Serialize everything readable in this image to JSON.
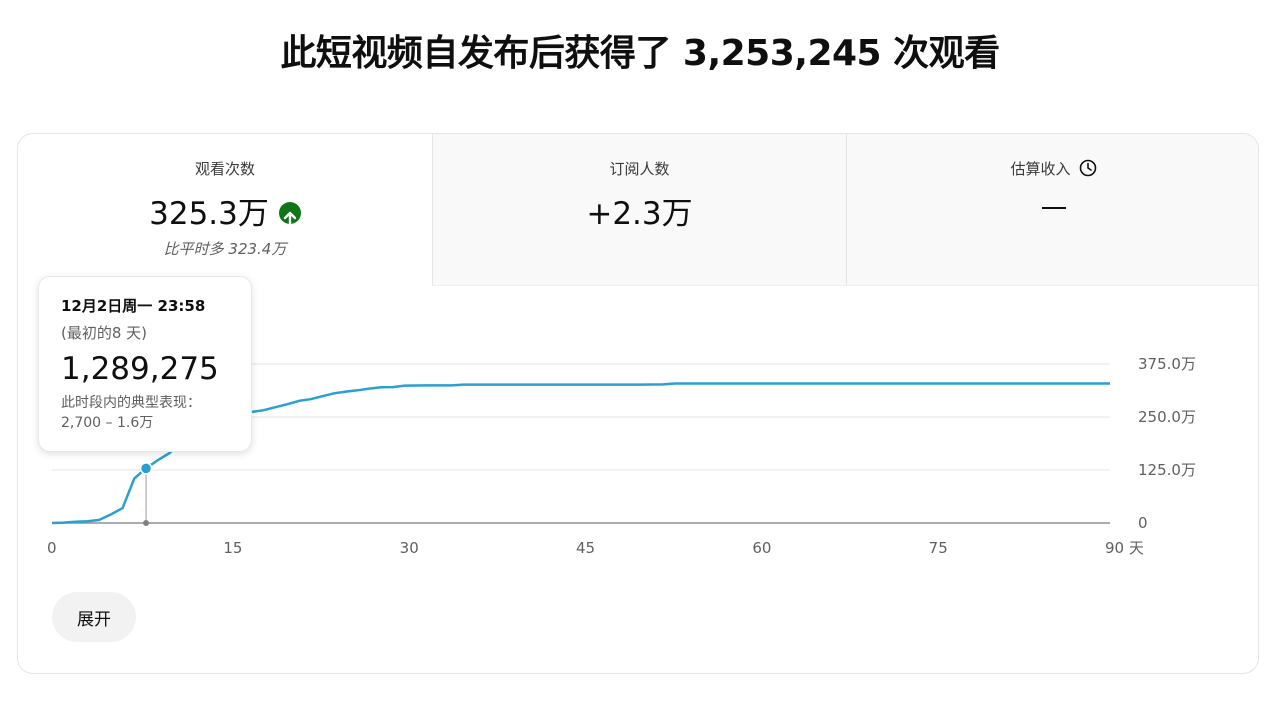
{
  "headline": "此短视频自发布后获得了 3,253,245 次观看",
  "tabs": [
    {
      "label": "观看次数",
      "value": "325.3万",
      "sub": "比平时多 323.4万",
      "trend_icon": "arrow-up-circle-icon"
    },
    {
      "label": "订阅人数",
      "value": "+2.3万"
    },
    {
      "label": "估算收入",
      "value": "",
      "icon": "clock-icon"
    }
  ],
  "tooltip": {
    "date": "12月2日周一 23:58",
    "range": "(最初的8 天)",
    "value": "1,289,275",
    "note_label": "此时段内的典型表现：",
    "note_range": "2,700 – 1.6万"
  },
  "expand_label": "展开",
  "colors": {
    "line": "#2aa0cf",
    "up": "#107516"
  },
  "chart_data": {
    "type": "line",
    "x_unit": "天",
    "x_ticks": [
      0,
      15,
      30,
      45,
      60,
      75,
      90
    ],
    "x_tick_labels": [
      "0",
      "15",
      "30",
      "45",
      "60",
      "75",
      "90 天"
    ],
    "y_ticks": [
      0,
      1250000,
      2500000,
      3750000
    ],
    "y_tick_labels": [
      "0",
      "125.0万",
      "250.0万",
      "375.0万"
    ],
    "xlim": [
      0,
      90
    ],
    "ylim": [
      0,
      3750000
    ],
    "grid": true,
    "highlight": {
      "x": 8,
      "y": 1289275
    },
    "series": [
      {
        "x": [
          0,
          1,
          2,
          3,
          4,
          5,
          6,
          7,
          8,
          9,
          10,
          11,
          12,
          13,
          14,
          15,
          16,
          17,
          18,
          19,
          20,
          21,
          22,
          23,
          24,
          25,
          26,
          27,
          28,
          29,
          30,
          32,
          34,
          35,
          40,
          45,
          50,
          52,
          53,
          60,
          70,
          80,
          90
        ],
        "y": [
          0,
          10000,
          30000,
          40000,
          70000,
          200000,
          350000,
          1050000,
          1289275,
          1480000,
          1650000,
          1900000,
          2150000,
          2350000,
          2480000,
          2550000,
          2580000,
          2620000,
          2660000,
          2730000,
          2800000,
          2880000,
          2920000,
          2990000,
          3060000,
          3100000,
          3130000,
          3170000,
          3200000,
          3205000,
          3240000,
          3245000,
          3245000,
          3265000,
          3265000,
          3265000,
          3265000,
          3270000,
          3290000,
          3290000,
          3290000,
          3290000,
          3290000
        ]
      }
    ]
  }
}
